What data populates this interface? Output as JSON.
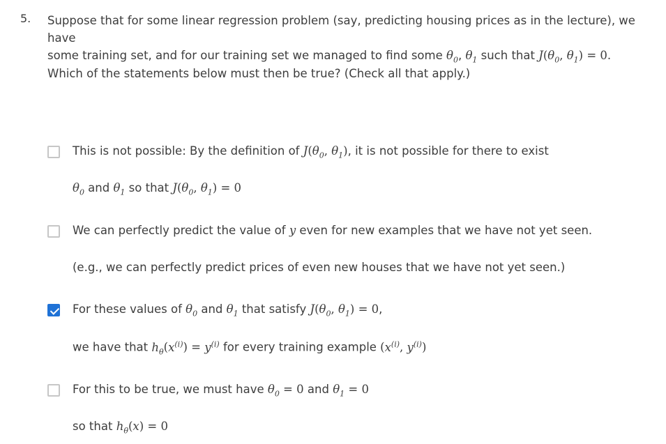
{
  "question": {
    "number": "5.",
    "line1": "Suppose that for some linear regression problem (say, predicting housing prices as in the lecture), we have",
    "line2_a": "some training set, and for our training set we managed to find some ",
    "line2_b": " such that ",
    "prompt": "Which of the statements below must then be true? (Check all that apply.)"
  },
  "options": [
    {
      "checked": false,
      "l1_a": "This is not possible: By the definition of ",
      "l1_b": ", it is not possible for there to exist",
      "l2_a": " and ",
      "l2_b": " so that "
    },
    {
      "checked": false,
      "l1_a": "We can perfectly predict the value of ",
      "l1_b": " even for new examples that we have not yet seen.",
      "l2": "(e.g., we can perfectly predict prices of even new houses that we have not yet seen.)"
    },
    {
      "checked": true,
      "l1_a": "For these values of ",
      "l1_b": " and ",
      "l1_c": " that satisfy ",
      "l1_d": ",",
      "l2_a": "we have that ",
      "l2_b": " for every training example "
    },
    {
      "checked": false,
      "l1_a": "For this to be true, we must have ",
      "l1_b": " and ",
      "l2_a": "so that "
    }
  ]
}
